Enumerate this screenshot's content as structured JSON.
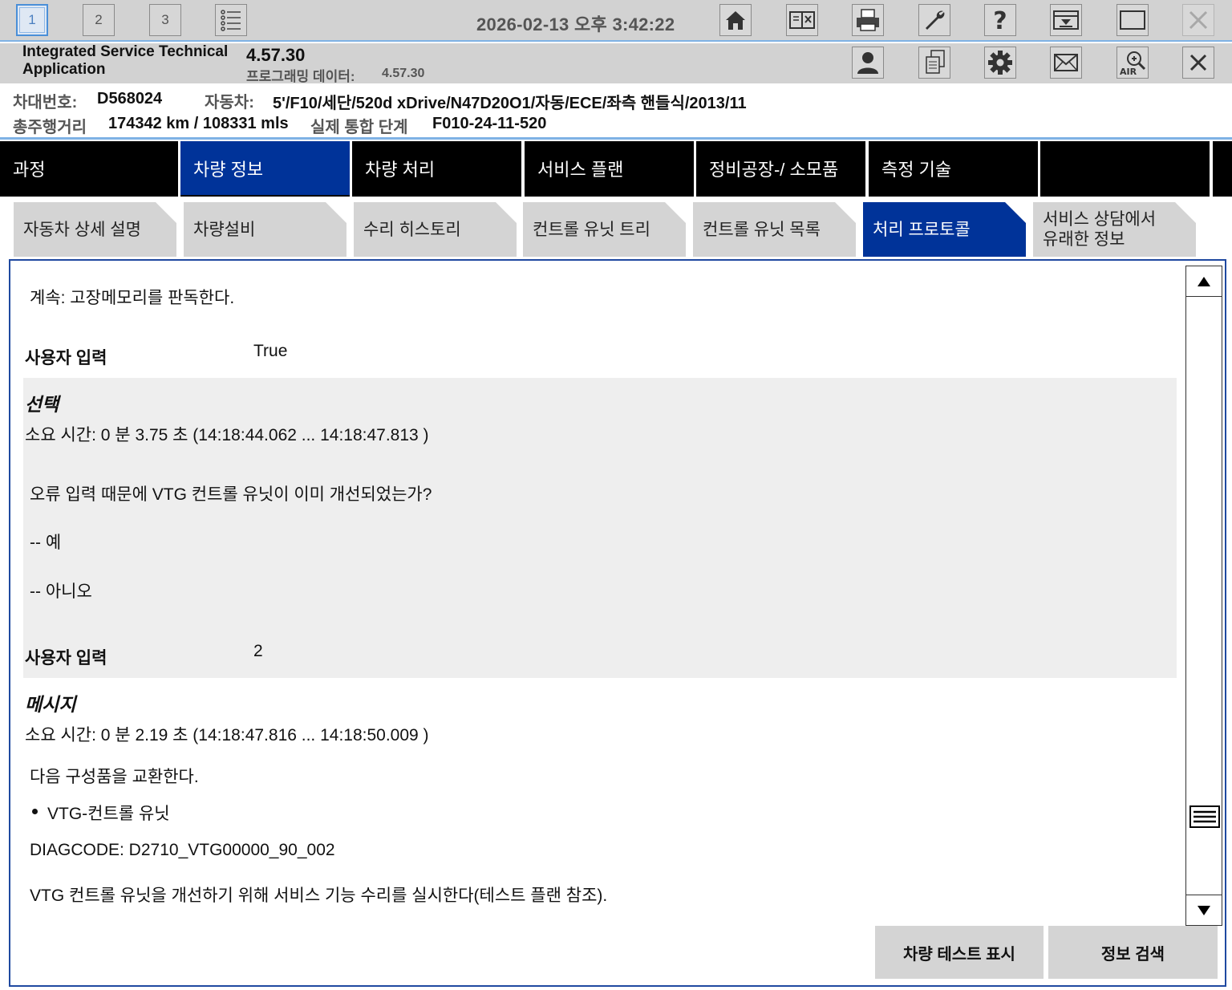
{
  "toolbar": {
    "workspaces": [
      "1",
      "2",
      "3"
    ],
    "datetime": "2026-02-13 오후 3:42:22",
    "icons": [
      "list-icon",
      "home-icon",
      "split-view-icon",
      "print-icon",
      "wrench-icon",
      "help-icon",
      "minimize-down-icon",
      "window-icon",
      "close-icon"
    ]
  },
  "app": {
    "name": "Integrated Service Technical Application",
    "version": "4.57.30",
    "programming_label": "프로그래밍 데이터:",
    "programming_value": "4.57.30"
  },
  "vehicle": {
    "chassis_label": "차대번호:",
    "chassis_value": "D568024",
    "vehicle_label": "자동차:",
    "vehicle_value": "5'/F10/세단/520d xDrive/N47D20O1/자동/ECE/좌측 핸들식/2013/11",
    "mileage_label": "총주행거리",
    "mileage_value": "174342 km / 108331 mls",
    "ilevel_label": "실제 통합 단계",
    "ilevel_value": "F010-24-11-520"
  },
  "main_tabs": [
    "과정",
    "차량 정보",
    "차량 처리",
    "서비스 플랜",
    "정비공장-/ 소모품",
    "측정 기술",
    ""
  ],
  "sub_tabs": [
    "자동차 상세 설명",
    "차량설비",
    "수리 히스토리",
    "컨트롤 유닛 트리",
    "컨트롤 유닛 목록",
    "처리 프로토콜",
    "서비스 상담에서 유래한 정보"
  ],
  "protocol": {
    "line_continue": "계속: 고장메모리를 판독한다.",
    "user_input_label": "사용자 입력",
    "user_input_1": "True",
    "section_select": "선택",
    "duration_1": "소요 시간: 0 분 3.75 초 (14:18:44.062 ... 14:18:47.813 )",
    "question": "오류 입력 때문에 VTG 컨트롤 유닛이 이미 개선되었는가?",
    "option_yes": "-- 예",
    "option_no": "-- 아니오",
    "user_input_2": "2",
    "section_message": "메시지",
    "duration_2": "소요 시간: 0 분 2.19 초 (14:18:47.816 ... 14:18:50.009 )",
    "replace_text": "다음 구성품을 교환한다.",
    "component": "VTG-컨트롤 유닛",
    "diagcode": "DIAGCODE: D2710_VTG00000_90_002",
    "service_text": "VTG 컨트롤 유닛을 개선하기 위해 서비스 기능 수리를 실시한다(테스트 플랜 참조)."
  },
  "buttons": {
    "vehicle_test": "차량 테스트 표시",
    "info_search": "정보 검색"
  }
}
